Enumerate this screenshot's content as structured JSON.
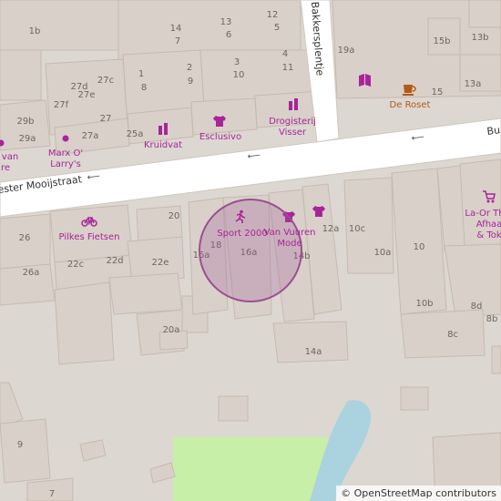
{
  "map": {
    "streets": {
      "bakkersplentje": "Bakkersplentje",
      "mooijstraat": "ester Mooijstraat",
      "east_street": "Bu"
    },
    "house_numbers": {
      "n1b": "1b",
      "n14": "14",
      "n7": "7",
      "n13": "13",
      "n6": "6",
      "n12": "12",
      "n5": "5",
      "n19a": "19a",
      "n15b": "15b",
      "n13b": "13b",
      "n15": "15",
      "n13a": "13a",
      "n27d": "27d",
      "n27e": "27e",
      "n27c": "27c",
      "n27f": "27f",
      "n1": "1",
      "n8": "8",
      "n2": "2",
      "n9": "9",
      "n3": "3",
      "n10": "10",
      "n4": "4",
      "n11": "11",
      "n29b": "29b",
      "n29a": "29a",
      "n27a": "27a",
      "n27": "27",
      "n25a": "25a",
      "n20": "20",
      "n26": "26",
      "n22c": "22c",
      "n22d": "22d",
      "n22e": "22e",
      "n26a": "26a",
      "n18": "18",
      "n16a": "16a",
      "n16aw": "16a",
      "n14b": "14b",
      "n12a": "12a",
      "n10c": "10c",
      "n10a": "10a",
      "n10b": "10b",
      "n8d": "8d",
      "n8b": "8b",
      "n8c": "8c",
      "n20a": "20a",
      "n14a": "14a"
    },
    "pois": {
      "de_roset": "De Roset",
      "kruidvat": "Kruidvat",
      "esclusivo": "Esclusivo",
      "drogisterij_1": "Drogisterij",
      "drogisterij_2": "Visser",
      "marx_1": "Marx O'",
      "marx_2": "Larry's",
      "van_1": "van",
      "van_2": "re",
      "pilkes": "Pilkes Fietsen",
      "sport2000": "Sport 2000",
      "vanvuuren_1": "Van Vuuren",
      "vanvuuren_2": "Mode",
      "laor_1": "La-Or Th",
      "laor_2": "Afhaa",
      "laor_3": "& Tok"
    },
    "icons": {
      "book": "book-icon",
      "coffee": "coffee-cup-icon",
      "cosmetics": "cosmetics-icon",
      "clothes": "shirt-icon",
      "bicycle": "bicycle-icon",
      "sports": "running-icon",
      "shop_cart": "shopping-cart-icon",
      "dot": "poi-dot-icon"
    },
    "colors": {
      "background": "#dcd7d1",
      "building": "#d9d0c9",
      "road": "#ffffff",
      "water": "#aad3df",
      "grass": "#c8efa8",
      "poi_purple": "#a8249a",
      "poi_brown": "#b45a14",
      "highlight_circle": "#a05a9a"
    }
  },
  "attribution": {
    "symbol": "©",
    "text": "OpenStreetMap contributors"
  }
}
